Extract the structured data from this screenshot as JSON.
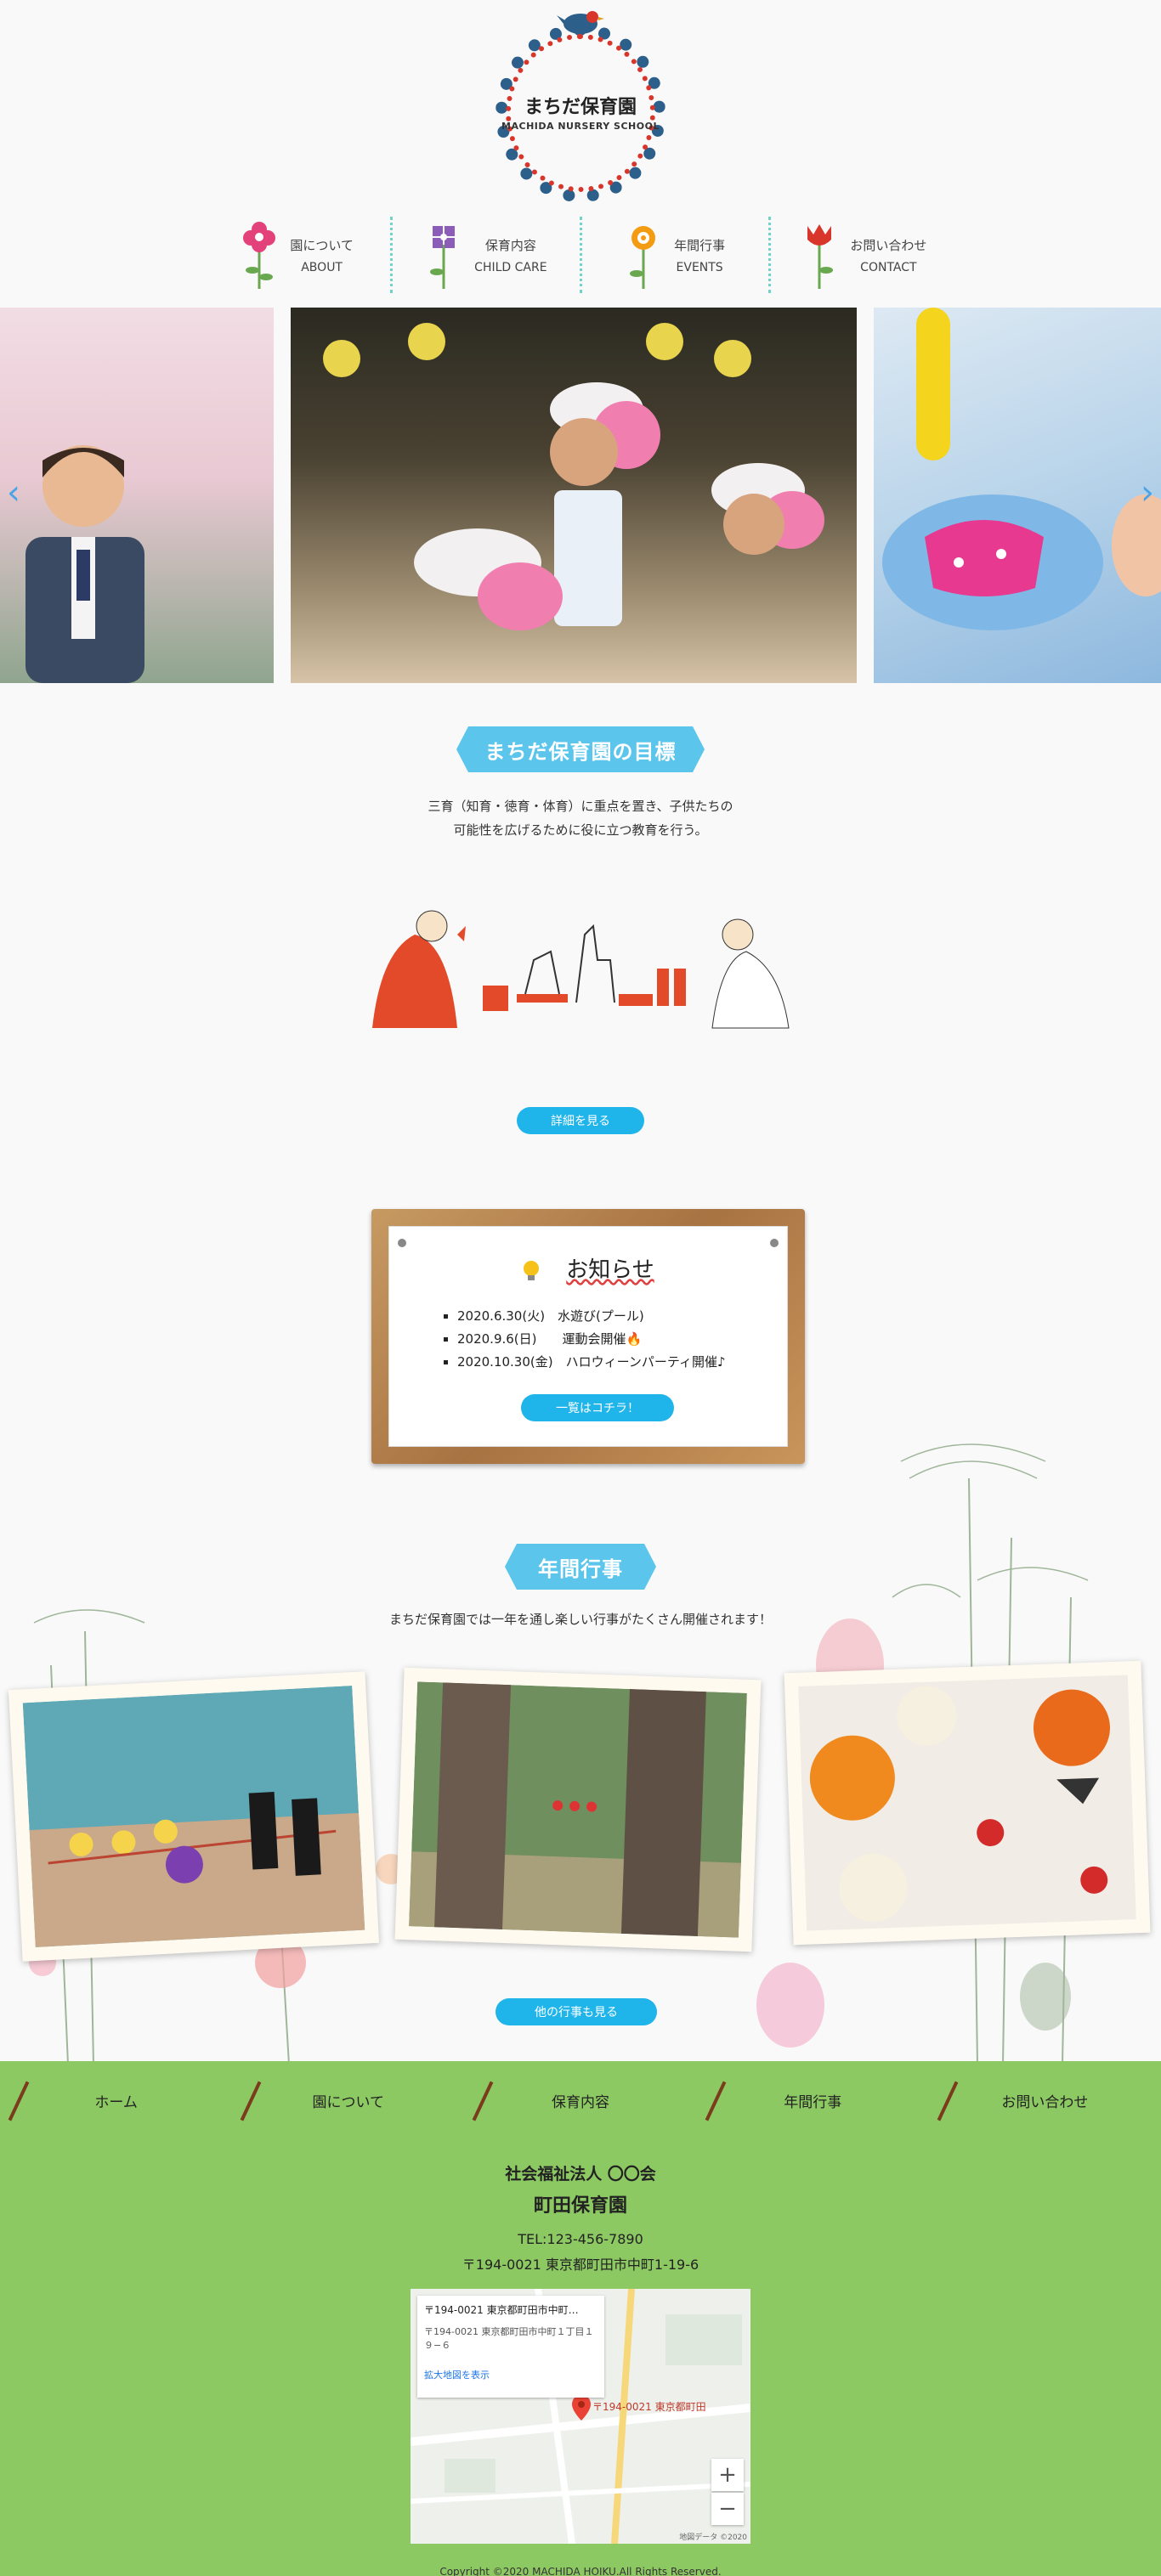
{
  "header": {
    "logo_jp": "まちだ保育園",
    "logo_en": "MACHIDA NURSERY SCHOOL"
  },
  "nav": [
    {
      "jp": "園について",
      "en": "ABOUT",
      "icon": "pink-flower-icon",
      "color": "#e2417a"
    },
    {
      "jp": "保育内容",
      "en": "CHILD CARE",
      "icon": "purple-flower-icon",
      "color": "#8b5cb8"
    },
    {
      "jp": "年間行事",
      "en": "EVENTS",
      "icon": "orange-flower-icon",
      "color": "#f39c12"
    },
    {
      "jp": "お問い合わせ",
      "en": "CONTACT",
      "icon": "tulip-icon",
      "color": "#d9362b"
    }
  ],
  "slider": {
    "prev": "‹",
    "next": "›"
  },
  "goal": {
    "title": "まちだ保育園の目標",
    "line1": "三育（知育・徳育・体育）に重点を置き、子供たちの",
    "line2": "可能性を広げるために役に立つ教育を行う。",
    "button": "詳細を見る"
  },
  "news": {
    "title": "お知らせ",
    "items": [
      "2020.6.30(火)　水遊び(プール)",
      "2020.9.6(日)　　運動会開催🔥",
      "2020.10.30(金)　ハロウィーンパーティ開催♪"
    ],
    "button": "一覧はコチラ！"
  },
  "events": {
    "title": "年間行事",
    "text": "まちだ保育園では一年を通し楽しい行事がたくさん開催されます！",
    "button": "他の行事も見る"
  },
  "footer": {
    "nav": [
      "ホーム",
      "園について",
      "保育内容",
      "年間行事",
      "お問い合わせ"
    ],
    "corp": "社会福祉法人 〇〇会",
    "school": "町田保育園",
    "tel": "TEL:123-456-7890",
    "address": "〒194-0021 東京都町田市中町1-19-6",
    "map": {
      "card_title": "〒194-0021 東京都町田市中町…",
      "card_sub": "〒194-0021 東京都町田市中町１丁目１９−６",
      "card_link": "拡大地図を表示",
      "pin_label": "〒194-0021 東京都町田",
      "zoom_in": "+",
      "zoom_out": "−",
      "attribution": "地図データ ©2020"
    },
    "copyright": "Copyright ©2020 MACHIDA HOIKU.All Rights Reserved."
  },
  "colors": {
    "accent": "#5bc5ec",
    "button": "#1fb4ea",
    "footer_bg": "#8dc963"
  }
}
